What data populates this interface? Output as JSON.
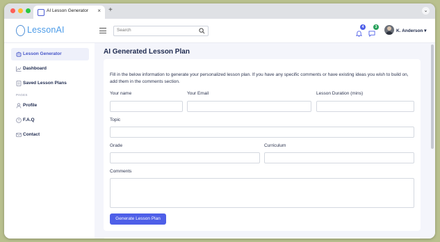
{
  "browser": {
    "tab_title": "AI Lesson Generator",
    "tab_close": "×",
    "new_tab": "+",
    "chevron": "⌄"
  },
  "header": {
    "logo_text": "LessonAI",
    "search_placeholder": "Search",
    "notifications_count": "4",
    "messages_count": "3",
    "user_name": "K. Anderson ▾",
    "colors": {
      "accent": "#4e5fe8",
      "notif_badge": "#4e5fe8",
      "msg_badge": "#27a05a"
    }
  },
  "sidebar": {
    "items": [
      {
        "label": "Lesson Generator",
        "icon": "robot-icon",
        "active": true
      },
      {
        "label": "Dashboard",
        "icon": "chart-icon",
        "active": false
      },
      {
        "label": "Saved Lesson Plans",
        "icon": "document-icon",
        "active": false
      }
    ],
    "section_label": "PAGES",
    "pages": [
      {
        "label": "Profile",
        "icon": "user-icon"
      },
      {
        "label": "F.A.Q",
        "icon": "help-icon"
      },
      {
        "label": "Contact",
        "icon": "mail-icon"
      }
    ]
  },
  "main": {
    "title": "AI Generated Lesson Plan",
    "intro": "Fill in the below information to generate your personalized lesson plan. If you have any specific comments or have existing ideas you wish to build on, add them in the comments section.",
    "fields": {
      "name": {
        "label": "Your name",
        "value": ""
      },
      "email": {
        "label": "Your Email",
        "value": ""
      },
      "duration": {
        "label": "Lesson Duration (mins)",
        "value": ""
      },
      "topic": {
        "label": "Topic",
        "value": ""
      },
      "grade": {
        "label": "Grade",
        "value": ""
      },
      "curriculum": {
        "label": "Curriculum",
        "value": ""
      },
      "comments": {
        "label": "Comments",
        "value": ""
      }
    },
    "submit_label": "Generate Lesson Plan"
  }
}
